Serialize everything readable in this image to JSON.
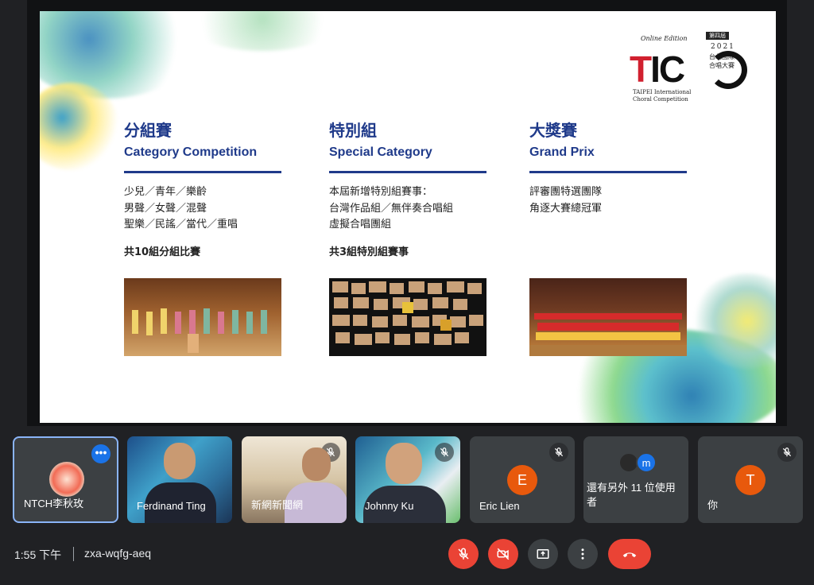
{
  "slide": {
    "logo": {
      "edition": "Online Edition",
      "year": "2021",
      "badge": "第四屆",
      "zh_name_line1": "台北國際",
      "zh_name_line2": "合唱大賽",
      "mark": "TIC",
      "en_line1": "TAIPEI International",
      "en_line2": "Choral Competition"
    },
    "columns": [
      {
        "zh_title": "分組賽",
        "en_title": "Category Competition",
        "lines": [
          "少兒／青年／樂齡",
          "男聲／女聲／混聲",
          "聖樂／民謠／當代／重唱"
        ],
        "summary": "共10組分組比賽"
      },
      {
        "zh_title": "特別組",
        "en_title": "Special Category",
        "lines": [
          "本屆新增特別組賽事：",
          "台灣作品組／無伴奏合唱組",
          "虛擬合唱團組"
        ],
        "summary": "共3組特別組賽事"
      },
      {
        "zh_title": "大獎賽",
        "en_title": "Grand Prix",
        "lines": [
          "評審團特選團隊",
          "角逐大賽總冠軍"
        ],
        "summary": ""
      }
    ]
  },
  "participants": [
    {
      "name": "NTCH李秋玫",
      "muted": false,
      "kind": "avatar"
    },
    {
      "name": "Ferdinand Ting",
      "muted": false,
      "kind": "video"
    },
    {
      "name": "新網新聞網",
      "muted": true,
      "kind": "video"
    },
    {
      "name": "Johnny Ku",
      "muted": true,
      "kind": "video"
    },
    {
      "name": "Eric Lien",
      "muted": true,
      "kind": "letter",
      "letter": "E"
    },
    {
      "name": "還有另外 11 位使用者",
      "muted": false,
      "kind": "others",
      "letter": "m"
    },
    {
      "name": "你",
      "muted": true,
      "kind": "letter",
      "letter": "T"
    }
  ],
  "bar": {
    "time": "1:55 下午",
    "meeting_code": "zxa-wqfg-aeq"
  },
  "colors": {
    "accent_blue": "#1f3a8a",
    "danger": "#ea4335",
    "tile_bg": "#3c4043",
    "active_border": "#8ab4f8"
  }
}
